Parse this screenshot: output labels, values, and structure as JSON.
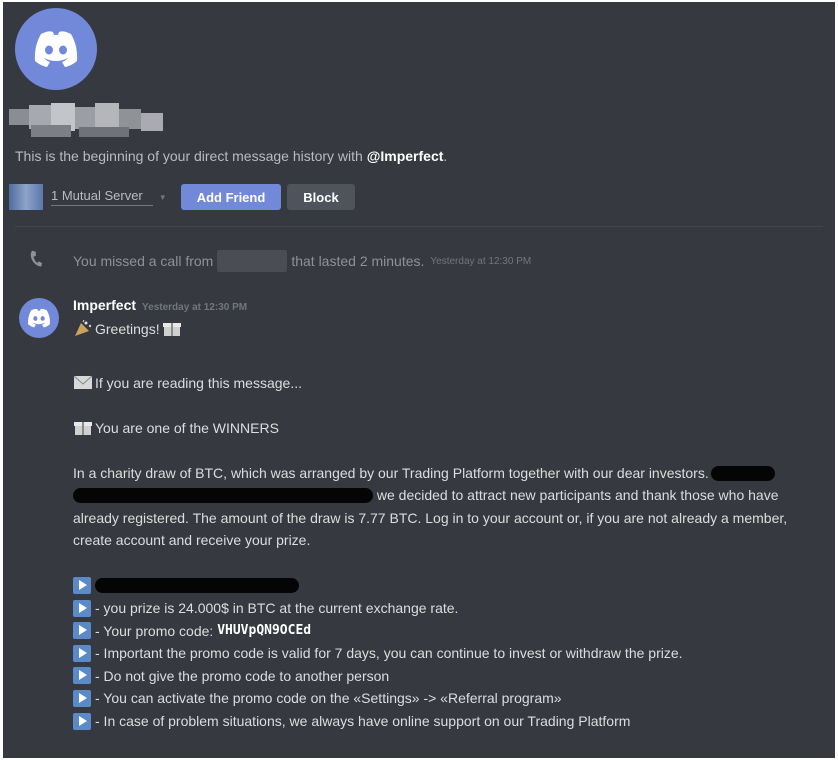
{
  "channel": {
    "intro_prefix": "This is the beginning of your direct message history with ",
    "intro_user": "@Imperfect",
    "intro_suffix": ".",
    "mutual_servers": "1 Mutual Server",
    "add_friend_label": "Add Friend",
    "block_label": "Block"
  },
  "call": {
    "text_before": "You missed a call from",
    "text_after": "that lasted 2 minutes.",
    "timestamp": "Yesterday at 12:30 PM"
  },
  "message": {
    "author": "Imperfect",
    "timestamp": "Yesterday at 12:30 PM",
    "greeting": "Greetings!",
    "line_reading": "If you are reading this message...",
    "line_winners": "You are one of the WINNERS",
    "para_1a": "In a charity draw of BTC, which was arranged by our Trading Platform together with our dear investors.",
    "para_1b": " we decided to attract new participants and thank those who have already registered. The amount of the draw is 7.77 BTC. Log in to your account or, if you are not already a member, create account and receive your prize.",
    "bullets": [
      "- you prize is 24.000$ in BTC at the current exchange rate.",
      "- Your promo code: ",
      "- Important the promo code is valid for 7 days, you can continue to invest or withdraw the prize.",
      "- Do not give the promo code to another person",
      "- You can activate the promo code on the «Settings» -> «Referral program»",
      "- In case of problem situations, we always have online support on our Trading Platform"
    ],
    "promo_code": "VHUVpQN9OCEd"
  },
  "colors": {
    "background": "#36393f",
    "blurple": "#7289da",
    "text": "#dcddde",
    "muted": "#8e9297"
  },
  "icons": {
    "avatar": "discord-logo-icon",
    "call": "phone-icon",
    "bullet": "play-button-icon"
  }
}
